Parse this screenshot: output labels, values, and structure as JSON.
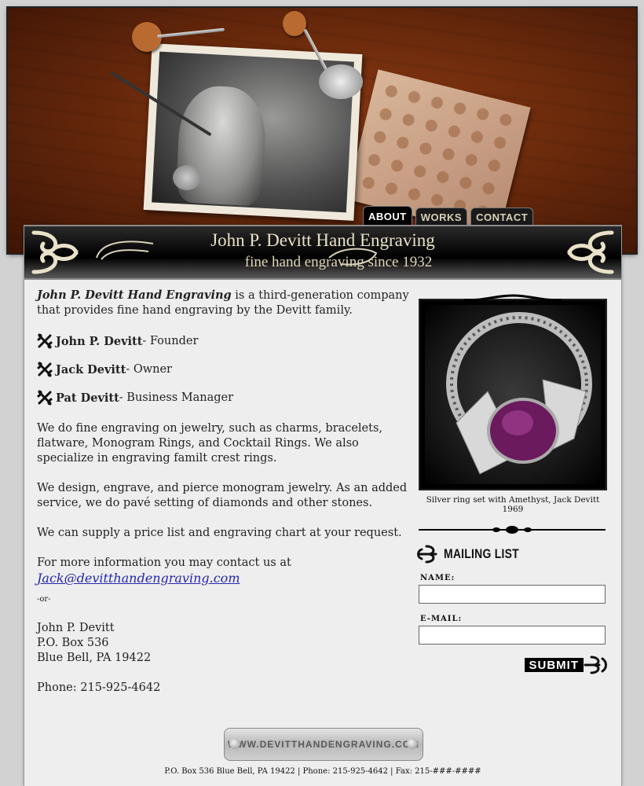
{
  "nav": {
    "tabs": [
      {
        "label": "ABOUT",
        "active": true
      },
      {
        "label": "WORKS",
        "active": false
      },
      {
        "label": "CONTACT",
        "active": false
      }
    ]
  },
  "banner": {
    "title": "John P. Devitt Hand Engraving",
    "subtitle": "fine hand engraving since 1932"
  },
  "main": {
    "intro_name": "John P. Devitt Hand Engraving",
    "intro_rest": " is a third-generation company that provides fine hand engraving by the Devitt family.",
    "people": [
      {
        "name": "John P. Devitt",
        "role": " - Founder"
      },
      {
        "name": "Jack Devitt",
        "role": " - Owner"
      },
      {
        "name": "Pat Devitt",
        "role": " - Business Manager"
      }
    ],
    "para1": "We do fine engraving on jewelry, such as charms, bracelets, flatware, Monogram Rings, and Cocktail Rings. We also specialize in engraving familt crest rings.",
    "para2": "We design, engrave, and pierce monogram jewelry. As an added service, we do pavé setting of diamonds and other stones.",
    "para3": "We can supply a price list and engraving chart at your request.",
    "contact_intro": "For more information you may contact us at",
    "email": "Jack@devitthandengraving.com",
    "or": "-or-",
    "address": [
      "John P. Devitt",
      "P.O. Box 536",
      "Blue Bell, PA 19422"
    ],
    "phone": "Phone: 215-925-4642"
  },
  "sidebar": {
    "caption": "Silver ring set with Amethyst, Jack Devitt 1969",
    "mailing_title": "MAILING LIST",
    "name_label": "NAME:",
    "email_label": "E-MAIL:",
    "submit_label": "SUBMIT"
  },
  "footer": {
    "badge": "WWW.DEVITTHANDENGRAVING.COM",
    "line": "P.O. Box 536 Blue Bell, PA 19422 | Phone: 215-925-4642 | Fax: 215-###-####"
  }
}
